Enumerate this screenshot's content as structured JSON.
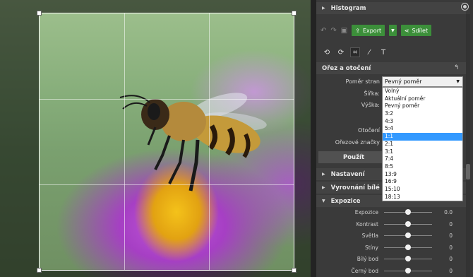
{
  "panel": {
    "histogram_title": "Histogram",
    "export_label": "Export",
    "share_label": "Sdílet",
    "crop_section_title": "Ořez a otočení",
    "aspect_label": "Poměr stran",
    "aspect_value": "Pevný poměr",
    "width_label": "Šířka:",
    "height_label": "Výška:",
    "rotation_label": "Otočení",
    "crop_marks_label": "Ořezové značky",
    "apply_label": "Použít",
    "settings_title": "Nastavení",
    "white_balance_title": "Vyrovnání bílé",
    "exposure_title": "Expozice"
  },
  "aspect_options": [
    "Volný",
    "Aktuální poměr",
    "Pevný poměr",
    "3:2",
    "4:3",
    "5:4",
    "1:1",
    "2:1",
    "3:1",
    "7:4",
    "8:5",
    "13:9",
    "16:9",
    "15:10",
    "18:13"
  ],
  "aspect_selected_index": 6,
  "sliders": [
    {
      "label": "Expozice",
      "value": "0.0",
      "level": 0.5
    },
    {
      "label": "Kontrast",
      "value": "0",
      "level": 0.5
    },
    {
      "label": "Světla",
      "value": "0",
      "level": 0.5
    },
    {
      "label": "Stíny",
      "value": "0",
      "level": 0.5
    },
    {
      "label": "Bílý bod",
      "value": "0",
      "level": 0.5
    },
    {
      "label": "Černý bod",
      "value": "0",
      "level": 0.5
    }
  ],
  "icons": {
    "histogram_toggle": "circle-dot-icon",
    "undo": "undo-icon",
    "redo": "redo-icon",
    "export": "export-icon",
    "share": "share-icon",
    "crop_tool": "crop-icon",
    "back": "back-arrow-icon"
  },
  "colors": {
    "accent_green": "#3c8f3a",
    "selection_blue": "#3399ff"
  }
}
